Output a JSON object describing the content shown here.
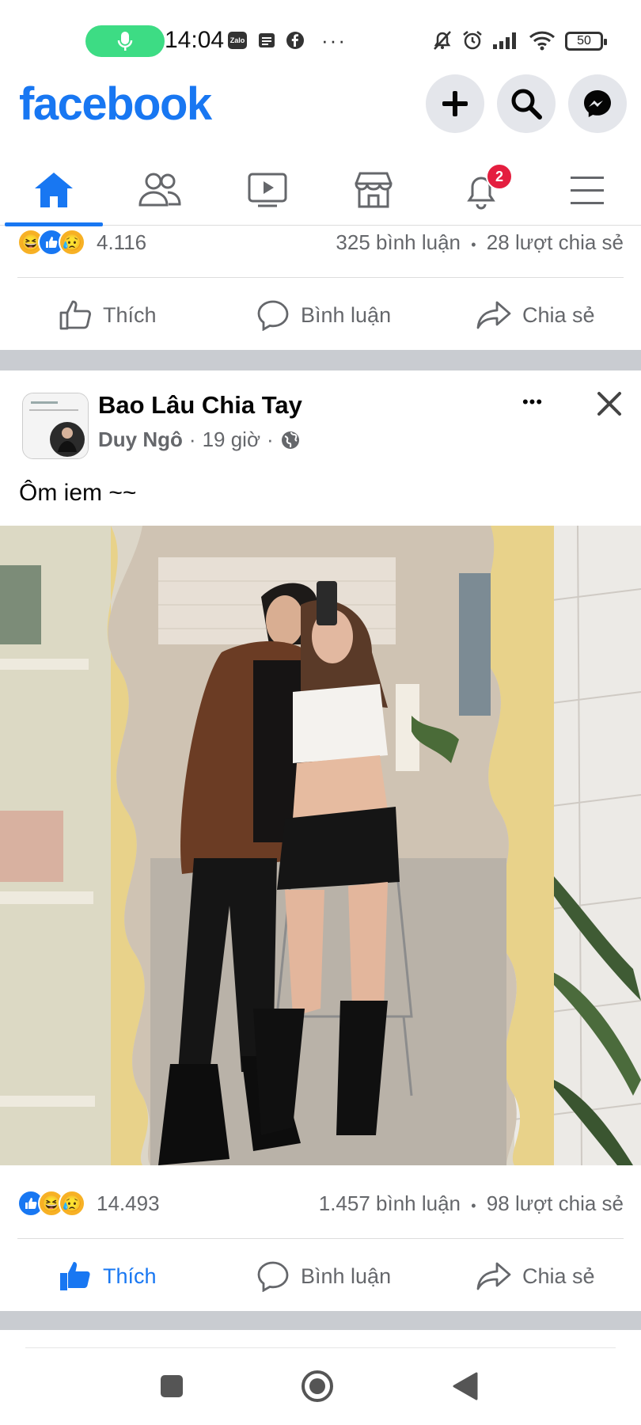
{
  "status_bar": {
    "time": "14:04",
    "icons": [
      "mic-icon",
      "zalo-icon",
      "message-icon",
      "facebook-icon",
      "more-icon",
      "mute-icon",
      "alarm-icon",
      "signal-icon",
      "wifi-icon"
    ],
    "zalo_label": "Zalo",
    "more_label": "···",
    "battery": "50"
  },
  "header": {
    "logo": "facebook"
  },
  "nav": {
    "notification_count": "2"
  },
  "prev_post": {
    "reaction_count": "4.116",
    "comments": "325 bình luận",
    "shares": "28 lượt chia sẻ",
    "sep": "•"
  },
  "actions": {
    "like": "Thích",
    "comment": "Bình luận",
    "share": "Chia sẻ"
  },
  "post": {
    "page_name": "Bao Lâu Chia Tay",
    "author": "Duy Ngô",
    "time": "19 giờ",
    "dot": "·",
    "caption": "Ôm iem ~~",
    "more": "•••",
    "reaction_count": "14.493",
    "comments": "1.457 bình luận",
    "shares": "98 lượt chia sẻ",
    "sep": "•"
  },
  "colors": {
    "brand": "#1877f2",
    "muted": "#65676b",
    "badge": "#e41e3f"
  }
}
